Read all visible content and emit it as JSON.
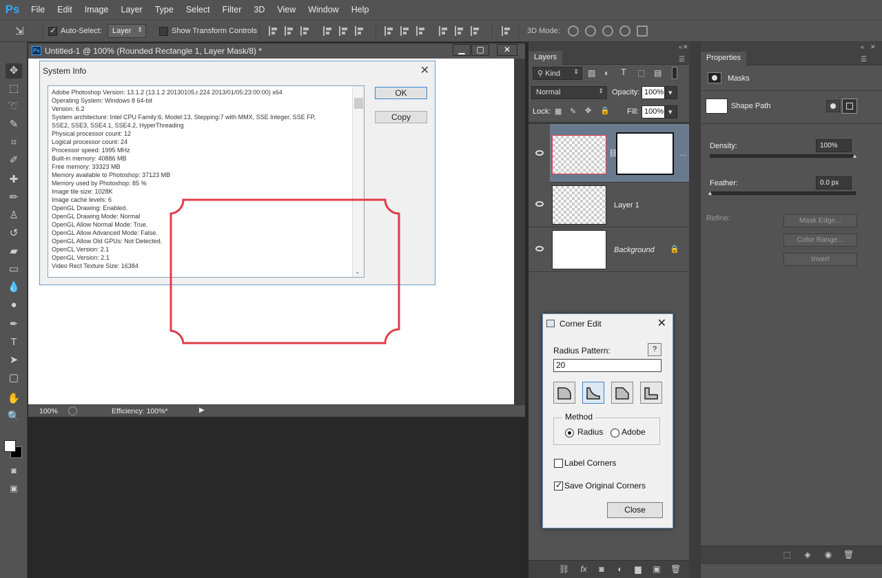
{
  "app": {
    "logo": "Ps"
  },
  "menu": [
    "File",
    "Edit",
    "Image",
    "Layer",
    "Type",
    "Select",
    "Filter",
    "3D",
    "View",
    "Window",
    "Help"
  ],
  "options": {
    "auto_select_label": "Auto-Select:",
    "auto_select_value": "Layer",
    "show_transform_label": "Show Transform Controls",
    "mode_3d_label": "3D Mode:"
  },
  "document": {
    "title": "Untitled-1 @ 100% (Rounded Rectangle 1, Layer Mask/8) *",
    "zoom": "100%",
    "efficiency": "Efficiency: 100%*"
  },
  "system_info": {
    "title": "System Info",
    "ok_label": "OK",
    "copy_label": "Copy",
    "lines": [
      "Adobe Photoshop Version: 13.1.2 (13.1.2 20130105.r.224 2013/01/05:23:00:00) x64",
      "Operating System: Windows 8 64-bit",
      "Version: 6.2",
      "System architecture: Intel CPU Family:6, Model:13, Stepping:7 with MMX, SSE Integer, SSE FP,",
      "SSE2, SSE3, SSE4.1, SSE4.2, HyperThreading",
      "Physical processor count: 12",
      "Logical processor count: 24",
      "Processor speed: 1995 MHz",
      "Built-in memory: 40886 MB",
      "Free memory: 33323 MB",
      "Memory available to Photoshop: 37123 MB",
      "Memory used by Photoshop: 85 %",
      "Image tile size: 1028K",
      "Image cache levels: 6",
      "OpenGL Drawing: Enabled.",
      "OpenGL Drawing Mode: Normal",
      "OpenGL Allow Normal Mode: True.",
      "OpenGL Allow Advanced Mode: False.",
      "OpenGL Allow Old GPUs: Not Detected.",
      "OpenCL Version: 2.1",
      "OpenGL Version: 2.1",
      "Video Rect Texture Size: 16384"
    ]
  },
  "layers_panel": {
    "tab": "Layers",
    "filter_kind": "Kind",
    "blend_mode": "Normal",
    "opacity_label": "Opacity:",
    "opacity_value": "100%",
    "lock_label": "Lock:",
    "fill_label": "Fill:",
    "fill_value": "100%",
    "layers": [
      {
        "name": ""
      },
      {
        "name": "Layer 1"
      },
      {
        "name": "Background"
      }
    ]
  },
  "properties_panel": {
    "tab": "Properties",
    "section": "Masks",
    "shape_path": "Shape Path",
    "density_label": "Density:",
    "density_value": "100%",
    "feather_label": "Feather:",
    "feather_value": "0.0 px",
    "refine_label": "Refine:",
    "mask_edge": "Mask Edge...",
    "color_range": "Color Range...",
    "invert": "Invert"
  },
  "corner_edit": {
    "title": "Corner Edit",
    "radius_pattern_label": "Radius Pattern:",
    "help": "?",
    "radius_value": "20",
    "method_legend": "Method",
    "radius_option": "Radius",
    "adobe_option": "Adobe",
    "label_corners": "Label Corners",
    "save_original": "Save Original Corners",
    "close_label": "Close"
  },
  "colors": {
    "accent": "#31a8ff",
    "shape_stroke": "#e03c47",
    "selected_layer": "#6a7a8e"
  }
}
